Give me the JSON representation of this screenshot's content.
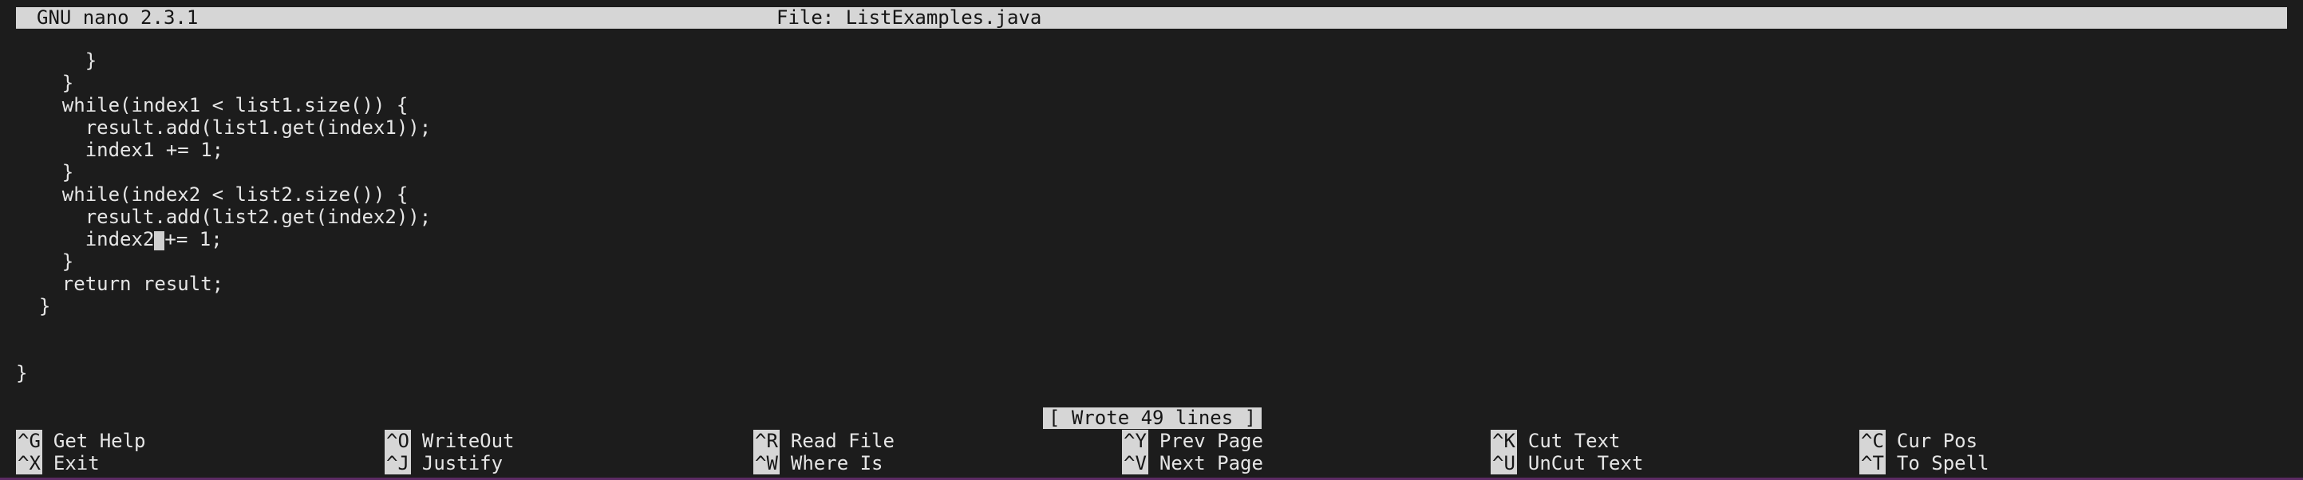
{
  "title_bar": {
    "app": "GNU nano 2.3.1",
    "file": "File: ListExamples.java"
  },
  "editor": {
    "lines": [
      "      }",
      "    }",
      "    while(index1 < list1.size()) {",
      "      result.add(list1.get(index1));",
      "      index1 += 1;",
      "    }",
      "    while(index2 < list2.size()) {",
      "      result.add(list2.get(index2));",
      "      index2 += 1;",
      "    }",
      "    return result;",
      "  }",
      "",
      "",
      "}"
    ],
    "cursor_line_before": "      index2",
    "cursor_char": " ",
    "cursor_line_after": "+= 1;"
  },
  "status": "[ Wrote 49 lines ]",
  "shortcuts": [
    {
      "key": "^G",
      "label": "Get Help"
    },
    {
      "key": "^O",
      "label": "WriteOut"
    },
    {
      "key": "^R",
      "label": "Read File"
    },
    {
      "key": "^Y",
      "label": "Prev Page"
    },
    {
      "key": "^K",
      "label": "Cut Text"
    },
    {
      "key": "^C",
      "label": "Cur Pos"
    },
    {
      "key": "^X",
      "label": "Exit"
    },
    {
      "key": "^J",
      "label": "Justify"
    },
    {
      "key": "^W",
      "label": "Where Is"
    },
    {
      "key": "^V",
      "label": "Next Page"
    },
    {
      "key": "^U",
      "label": "UnCut Text"
    },
    {
      "key": "^T",
      "label": "To Spell"
    }
  ],
  "colors": {
    "background": "#1c1c1c",
    "text": "#e6e6e6",
    "inverse_bg": "#d6d6d6",
    "inverse_text": "#151515"
  }
}
